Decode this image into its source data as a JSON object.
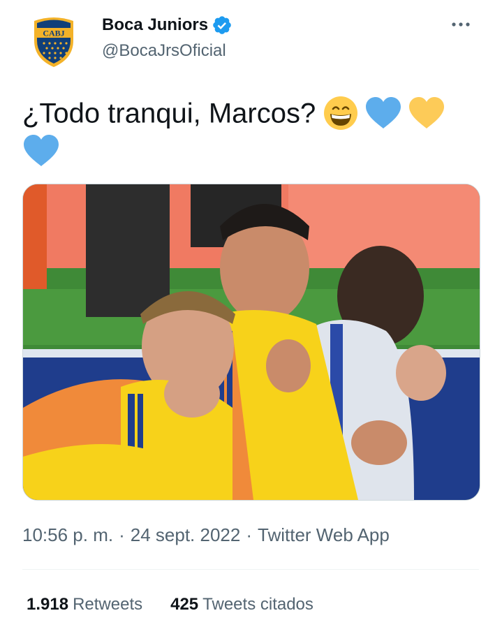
{
  "author": {
    "display_name": "Boca Juniors",
    "handle": "@BocaJrsOficial",
    "verified": true,
    "avatar_text": "CABJ",
    "avatar_icon": "boca-juniors-crest-icon"
  },
  "tweet": {
    "text": "¿Todo tranqui, Marcos?",
    "emojis": [
      "grinning-face-emoji",
      "blue-heart-emoji",
      "yellow-heart-emoji",
      "blue-heart-emoji"
    ]
  },
  "media": {
    "type": "photo",
    "icon": "photo-icon"
  },
  "meta": {
    "time": "10:56 p. m.",
    "separator": "·",
    "date": "24 sept. 2022",
    "source": "Twitter Web App"
  },
  "stats": {
    "retweets_count": "1.918",
    "retweets_label": "Retweets",
    "quotes_count": "425",
    "quotes_label": "Tweets citados"
  },
  "colors": {
    "text_primary": "#0f1419",
    "text_secondary": "#536471",
    "verified_blue": "#1d9bf0",
    "boca_blue": "#103f79",
    "boca_gold": "#f3b229",
    "heart_blue": "#5dadec",
    "heart_yellow": "#fdcb58"
  }
}
